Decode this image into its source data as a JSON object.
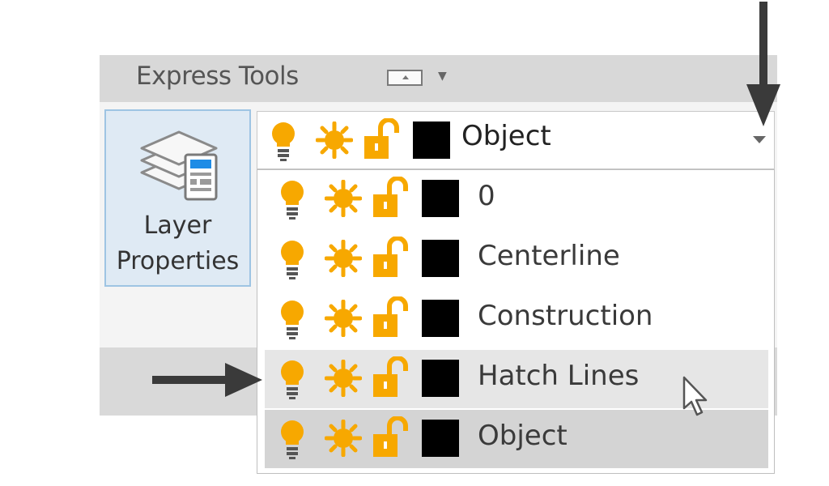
{
  "ribbon": {
    "tab_title": "Express Tools",
    "layer_button_label_line1": "Layer",
    "layer_button_label_line2": "Properties"
  },
  "layer_combo": {
    "current_layer": "Object",
    "layer_color": "#000000"
  },
  "layer_dropdown": {
    "items": [
      {
        "name": "0",
        "state": "normal"
      },
      {
        "name": "Centerline",
        "state": "normal"
      },
      {
        "name": "Construction",
        "state": "normal"
      },
      {
        "name": "Hatch Lines",
        "state": "hover"
      },
      {
        "name": "Object",
        "state": "selected"
      }
    ]
  },
  "colors": {
    "icon_orange": "#f7a800",
    "highlight_border": "#9ec4e3",
    "hover_background": "#e6e6e6",
    "selected_background": "#d4d4d4"
  },
  "icons": [
    "lightbulb-on-icon",
    "sun-thaw-icon",
    "unlock-icon",
    "color-swatch",
    "layer-properties-icon",
    "dropdown-arrow-icon",
    "mouse-cursor-icon"
  ]
}
